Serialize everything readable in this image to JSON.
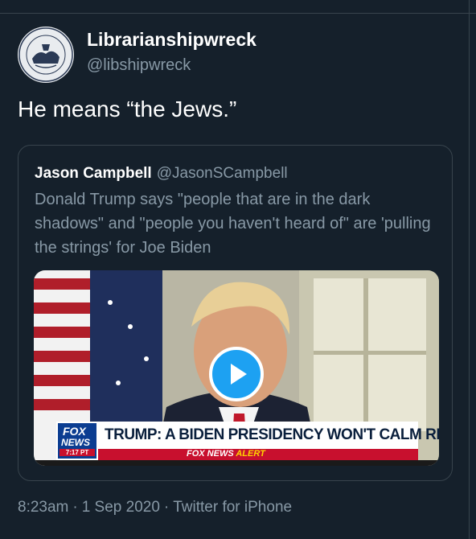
{
  "tweet": {
    "author_name": "Librarianshipwreck",
    "author_handle": "@libshipwreck",
    "text": "He means “the Jews.”",
    "timestamp": "8:23am",
    "date": "1 Sep 2020",
    "separator": "·",
    "source": "Twitter for iPhone"
  },
  "quoted": {
    "author_name": "Jason Campbell",
    "author_handle": "@JasonSCampbell",
    "text": "Donald Trump says \"people that are in the dark shadows\" and \"people you haven't heard of\" are 'pulling the strings' for Joe Biden"
  },
  "video": {
    "logo_top": "FOX",
    "logo_bottom": "NEWS",
    "logo_time": "7:17 PT",
    "headline": "TRUMP: A BIDEN PRESIDENCY WON'T CALM RIOTS",
    "alert_prefix": "FOX NEWS",
    "alert_word": "ALERT"
  },
  "colors": {
    "background": "#15202b",
    "border": "#38444d",
    "secondary_text": "#8899a6",
    "accent": "#1da1f2"
  }
}
